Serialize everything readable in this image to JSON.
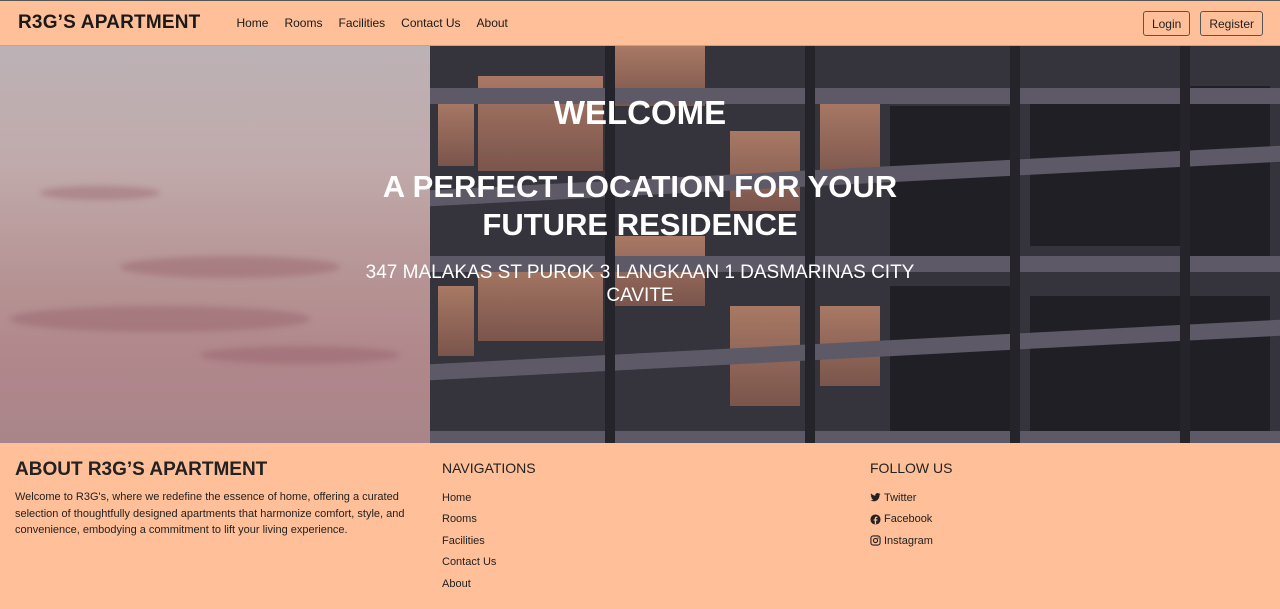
{
  "navbar": {
    "brand": "R3G’S APARTMENT",
    "links": [
      "Home",
      "Rooms",
      "Facilities",
      "Contact Us",
      "About"
    ],
    "login_label": "Login",
    "register_label": "Register"
  },
  "hero": {
    "welcome": "WELCOME",
    "tagline": "A PERFECT LOCATION FOR YOUR FUTURE RESIDENCE",
    "address": "347 MALAKAS ST PUROK 3 LANGKAAN 1 DASMARINAS CITY CAVITE"
  },
  "footer": {
    "about_title": "ABOUT R3G’S APARTMENT",
    "about_text": "Welcome to R3G's, where we redefine the essence of home, offering a curated selection of thoughtfully designed apartments that harmonize comfort, style, and convenience, embodying a commitment to lift your living experience.",
    "nav_title": "NAVIGATIONS",
    "nav_links": [
      "Home",
      "Rooms",
      "Facilities",
      "Contact Us",
      "About"
    ],
    "follow_title": "FOLLOW US",
    "social": [
      {
        "label": "Twitter",
        "icon": "twitter-icon"
      },
      {
        "label": "Facebook",
        "icon": "facebook-icon"
      },
      {
        "label": "Instagram",
        "icon": "instagram-icon"
      }
    ]
  }
}
